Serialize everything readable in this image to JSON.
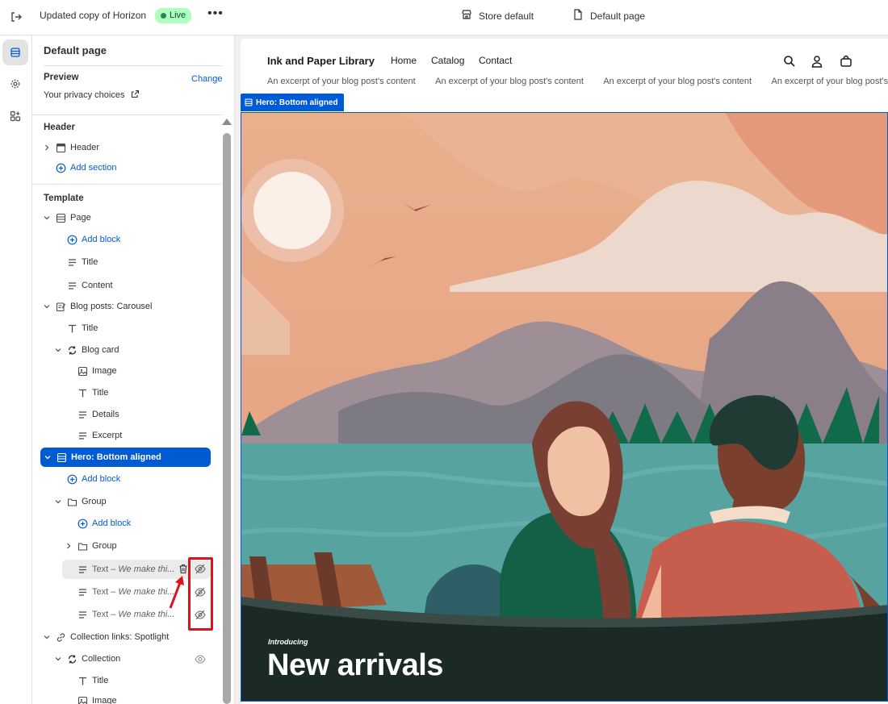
{
  "topbar": {
    "theme_name": "Updated copy of Horizon",
    "status": "Live",
    "more": "•••",
    "store": "Store default",
    "page": "Default page"
  },
  "panel": {
    "title": "Default page",
    "preview_label": "Preview",
    "preview_change": "Change",
    "preview_value": "Your privacy choices",
    "header_group": "Header",
    "template_group": "Template",
    "items": {
      "header": "Header",
      "add_section": "Add section",
      "page": "Page",
      "add_block_1": "Add block",
      "title_1": "Title",
      "content": "Content",
      "blog_posts": "Blog posts: Carousel",
      "title_2": "Title",
      "blog_card": "Blog card",
      "image_1": "Image",
      "title_3": "Title",
      "details": "Details",
      "excerpt": "Excerpt",
      "hero": "Hero: Bottom aligned",
      "add_block_2": "Add block",
      "group_1": "Group",
      "add_block_3": "Add block",
      "group_2": "Group",
      "text_prefix": "Text",
      "text_suffix": "– We make thi...",
      "collection_links": "Collection links: Spotlight",
      "collection": "Collection",
      "title_4": "Title",
      "image_2": "Image"
    }
  },
  "preview": {
    "store_name": "Ink and Paper Library",
    "nav": [
      "Home",
      "Catalog",
      "Contact"
    ],
    "excerpt": "An excerpt of your blog post's content",
    "hero_tag": "Hero: Bottom aligned",
    "hero_intro": "Introducing",
    "hero_headline": "New arrivals"
  },
  "colors": {
    "accent": "#005bd3",
    "highlight": "#e0111a",
    "live_bg": "#affebf"
  }
}
